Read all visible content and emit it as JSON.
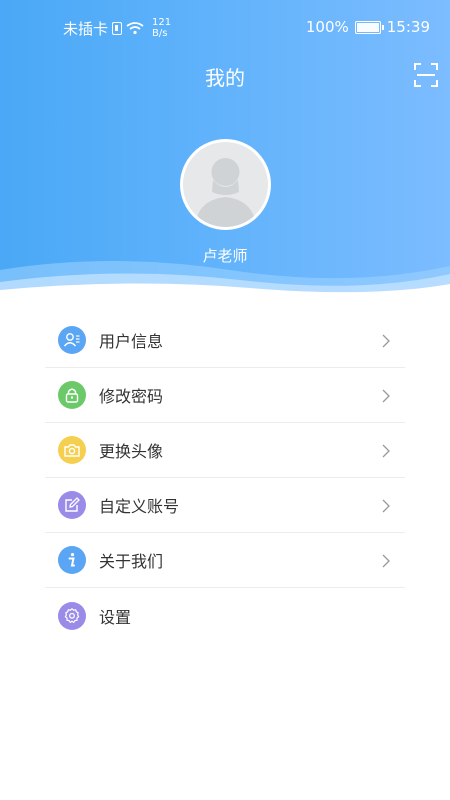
{
  "status_bar": {
    "carrier": "未插卡",
    "net_speed_value": "121",
    "net_speed_unit": "B/s",
    "battery": "100%",
    "time": "15:39"
  },
  "header": {
    "title": "我的",
    "username": "卢老师"
  },
  "menu": {
    "items": [
      {
        "label": "用户信息",
        "icon": "user-info-icon",
        "color": "#5aa5f4"
      },
      {
        "label": "修改密码",
        "icon": "lock-icon",
        "color": "#6cc96a"
      },
      {
        "label": "更换头像",
        "icon": "camera-icon",
        "color": "#f5cf4f"
      },
      {
        "label": "自定义账号",
        "icon": "edit-icon",
        "color": "#9b8be8"
      },
      {
        "label": "关于我们",
        "icon": "info-icon",
        "color": "#5aa5f4"
      },
      {
        "label": "设置",
        "icon": "settings-gear-icon",
        "color": "#9b8be8"
      }
    ]
  },
  "colors": {
    "header_start": "#4aa8f6",
    "header_end": "#7cbcff"
  }
}
